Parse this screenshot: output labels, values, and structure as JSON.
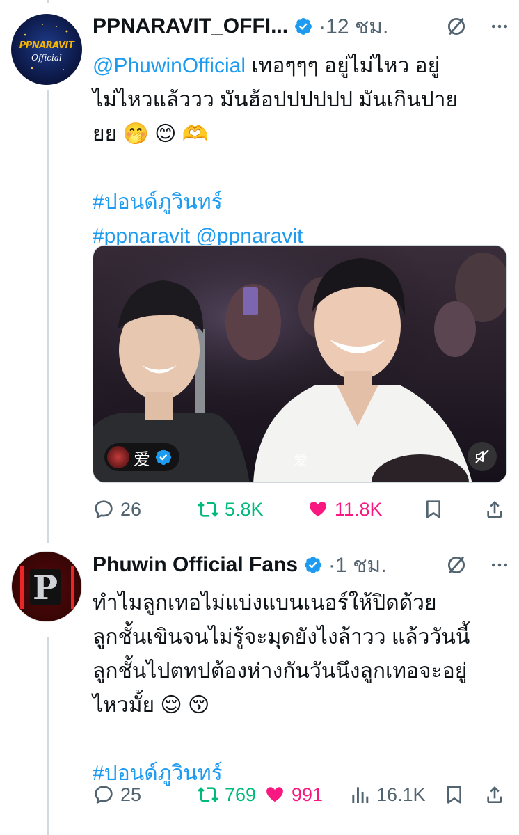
{
  "tweets": [
    {
      "author": "PPNARAVIT_OFFI...",
      "time": "12 ชม.",
      "avatar_text": "PPNARAVIT",
      "avatar_sub": "Official",
      "text_mention": "@PhuwinOfficial",
      "text_line1_rest": " เทอๆๆๆ อยู่ไม่ไหว อยู่",
      "text_line2": "ไม่ไหวแล้ววว มันฮ้อปปปปปป มันเกินปาย",
      "text_line3": "ยย 🤭 😊 🫶",
      "hashtag1": "#ปอนด์ภูวินทร์",
      "hashtag2": "#ppnaravit",
      "mention2": "@ppnaravit",
      "media_badge": "爱",
      "media_watermark": "爱",
      "replies": "26",
      "reposts": "5.8K",
      "likes": "11.8K"
    },
    {
      "author": "Phuwin Official Fans",
      "time": "1 ชม.",
      "avatar_letter": "P",
      "line1": "ทำไมลูกเทอไม่แบ่งแบนเนอร์ให้ปิดด้วย",
      "line2": "ลูกชั้นเขินจนไม่รู้จะมุดยังไงล้าวว แล้ววันนี้",
      "line3": "ลูกชั้นไปตทปต้องห่างกันวันนึงลูกเทอจะอยู่",
      "line4": "ไหวมั้ย 😌 😚",
      "hashtag": "#ปอนด์ภูวินทร์",
      "replies": "25",
      "reposts": "769",
      "likes": "991",
      "views": "16.1K"
    }
  ],
  "colors": {
    "accent": "#1d9bf0",
    "like": "#f91880",
    "repost": "#00ba7c",
    "muted": "#536471"
  }
}
